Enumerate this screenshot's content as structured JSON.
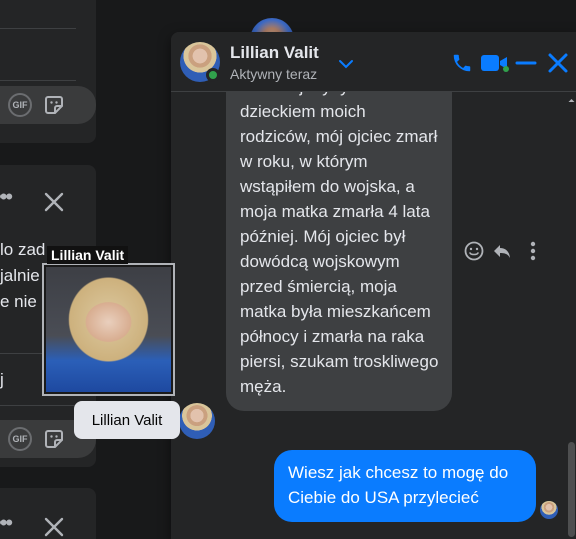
{
  "background": {
    "card1_icons": [
      "GIF",
      "sticker-icon"
    ],
    "card2_lines": [
      "lo zad",
      "jalnie",
      "e nie"
    ],
    "card2_input_char": "j",
    "card2_icons": [
      "GIF",
      "sticker-icon"
    ]
  },
  "chat": {
    "name": "Lillian Valit",
    "status": "Aktywny teraz",
    "incoming_message": "Jestem jedynym dzieckiem moich rodziców, mój ojciec zmarł w roku, w którym wstąpiłem do wojska, a moja matka zmarła 4 lata później. Mój ojciec był dowódcą wojskowym przed śmiercią, moja matka była mieszkańcem północy i zmarła na raka piersi, szukam troskliwego męża.",
    "outgoing_message": "Wiesz jak chcesz to mogę do Ciebie do USA przylecieć",
    "colors": {
      "accent": "#0a7cff",
      "online": "#31a24c",
      "bubble_in": "#3e4042"
    }
  },
  "hover_card": {
    "label": "Lillian Valit",
    "tooltip": "Lillian Valit"
  }
}
